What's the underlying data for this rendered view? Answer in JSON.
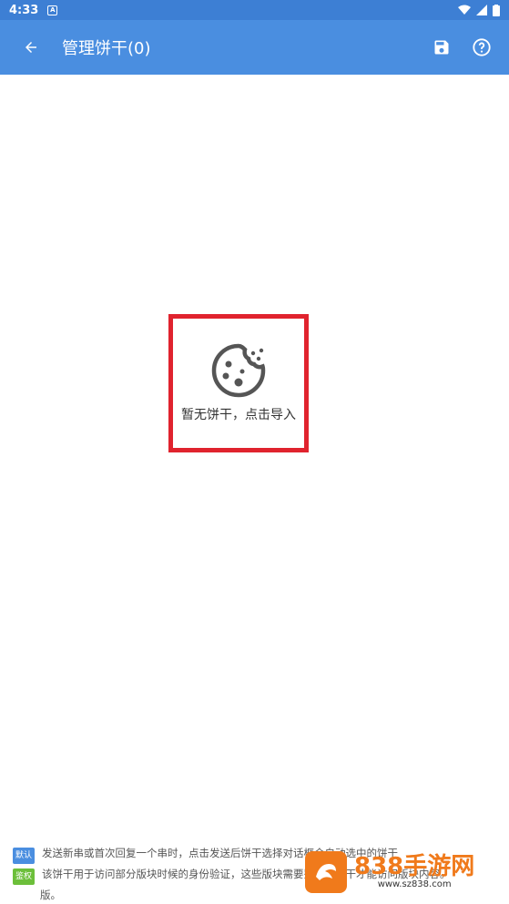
{
  "status_bar": {
    "time": "4:33",
    "notif_letter": "A"
  },
  "app_bar": {
    "title": "管理饼干(0)"
  },
  "empty_state": {
    "text": "暂无饼干，点击导入"
  },
  "footer": {
    "rows": [
      {
        "badge": "默认",
        "text": "发送新串或首次回复一个串时，点击发送后饼干选择对话框会自动选中的饼干"
      },
      {
        "badge": "鉴权",
        "text": "该饼干用于访问部分版块时候的身份验证，这些版块需要鉴权的饼干才能访问版块内容。"
      },
      {
        "badge": "",
        "text": "版。"
      }
    ]
  },
  "watermark": {
    "brand": "838手游网",
    "url": "www.sz838.com"
  },
  "colors": {
    "app_bar": "#4a8ee0",
    "status_bar": "#3d7fd4",
    "highlight": "#e0232e"
  }
}
